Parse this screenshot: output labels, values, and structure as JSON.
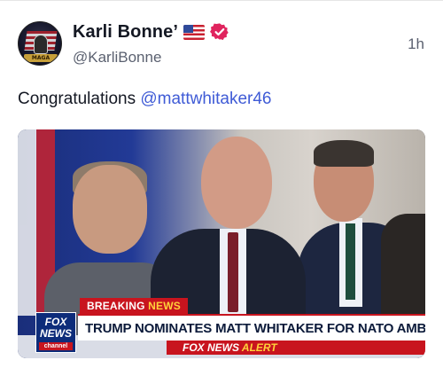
{
  "tweet": {
    "author": {
      "display_name": "Karli Bonne’",
      "flag_emoji": "US flag",
      "verified": true,
      "handle": "@KarliBonne",
      "avatar_text": "MAGA"
    },
    "timestamp": "1h",
    "text_prefix": "Congratulations ",
    "mention": "@mattwhitaker46",
    "media": {
      "chyron": {
        "tag_breaking": "BREAKING",
        "tag_news": "NEWS",
        "headline": "TRUMP NOMINATES MATT WHITAKER FOR NATO AMBASSADOR",
        "alert_brand": "FOX NEWS",
        "alert_word": "ALERT",
        "logo_line1": "FOX",
        "logo_line2": "NEWS",
        "logo_line3": "channel"
      }
    }
  },
  "colors": {
    "mention": "#3f5bd6",
    "verified_badge": "#e0245e",
    "fox_red": "#c8141e",
    "fox_blue": "#0d2c7a"
  }
}
